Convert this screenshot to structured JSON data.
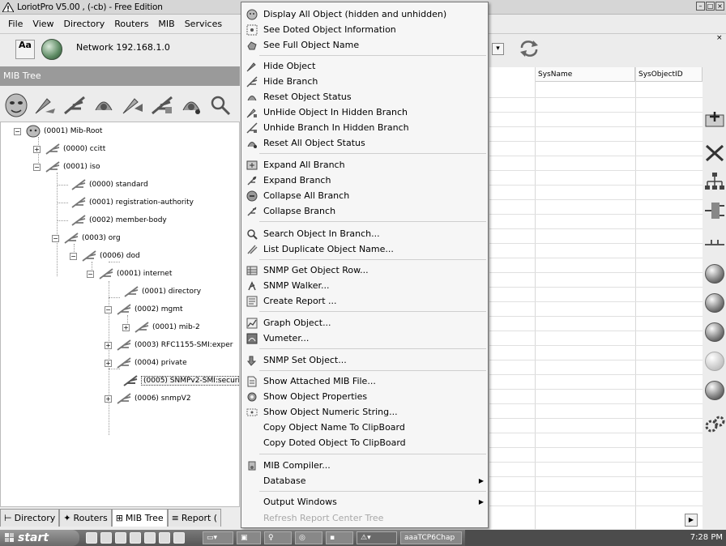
{
  "app": {
    "title": "LoriotPro V5.00 , (-cb) - Free Edition",
    "menus": [
      "File",
      "View",
      "Directory",
      "Routers",
      "MIB",
      "Services"
    ]
  },
  "toolbar": {
    "aa_label": "Aa",
    "network_label": "Network 192.168.1.0"
  },
  "mib_panel": {
    "header": "MIB Tree"
  },
  "tree": {
    "nodes": [
      {
        "label": "(0001) Mib-Root",
        "expander": "⊟"
      },
      {
        "label": "(0000) ccitt",
        "expander": "⊞"
      },
      {
        "label": "(0001) iso",
        "expander": "⊟"
      },
      {
        "label": "(0000) standard",
        "expander": ""
      },
      {
        "label": "(0001) registration-authority",
        "expander": ""
      },
      {
        "label": "(0002) member-body",
        "expander": ""
      },
      {
        "label": "(0003) org",
        "expander": "⊟"
      },
      {
        "label": "(0006) dod",
        "expander": "⊟"
      },
      {
        "label": "(0001) internet",
        "expander": "⊟"
      },
      {
        "label": "(0001) directory",
        "expander": ""
      },
      {
        "label": "(0002) mgmt",
        "expander": "⊟"
      },
      {
        "label": "(0001) mib-2",
        "expander": "⊞"
      },
      {
        "label": "(0003) RFC1155-SMI:exper",
        "expander": "⊞"
      },
      {
        "label": "(0004) private",
        "expander": "⊞"
      },
      {
        "label": "(0005) SNMPv2-SMI:securit",
        "expander": ""
      },
      {
        "label": "(0006) snmpV2",
        "expander": "⊞"
      }
    ]
  },
  "tabs": [
    "Directory",
    "Routers",
    "MIB Tree",
    "Report ("
  ],
  "table": {
    "columns": [
      "SysName",
      "SysObjectID"
    ]
  },
  "context_menu": {
    "items": [
      {
        "label": "Display All Object  (hidden and unhidden)"
      },
      {
        "label": "See Doted Object  Information"
      },
      {
        "label": "See Full Object Name"
      },
      {
        "label": "Hide Object"
      },
      {
        "label": "Hide Branch"
      },
      {
        "label": "Reset Object Status"
      },
      {
        "label": "UnHide Object In Hidden Branch"
      },
      {
        "label": "Unhide Branch In Hidden Branch"
      },
      {
        "label": "Reset All Object Status"
      },
      {
        "label": "Expand All Branch"
      },
      {
        "label": "Expand Branch"
      },
      {
        "label": "Collapse All Branch"
      },
      {
        "label": "Collapse Branch"
      },
      {
        "label": "Search Object In Branch..."
      },
      {
        "label": "List Duplicate Object Name..."
      },
      {
        "label": "SNMP Get Object Row..."
      },
      {
        "label": "SNMP Walker..."
      },
      {
        "label": "Create Report ..."
      },
      {
        "label": "Graph Object..."
      },
      {
        "label": "Vumeter..."
      },
      {
        "label": "SNMP Set Object..."
      },
      {
        "label": "Show Attached MIB File..."
      },
      {
        "label": "Show Object Properties"
      },
      {
        "label": "Show Object Numeric String..."
      },
      {
        "label": "Copy Object Name To ClipBoard"
      },
      {
        "label": "Copy Doted Object To ClipBoard"
      },
      {
        "label": "MIB Compiler..."
      },
      {
        "label": "Database",
        "submenu": "▶"
      },
      {
        "label": "Output Windows",
        "submenu": "▶"
      },
      {
        "label": "Refresh Report Center Tree",
        "disabled": true
      }
    ]
  },
  "taskbar": {
    "start_label": "start",
    "task1_label": "aaaTCP6Chap",
    "clock": "7:28 PM"
  },
  "colors": {
    "mib_header_bg": "#9a9a9a",
    "menu_bg": "#f6f6f6",
    "taskbar_bg": "#666666"
  }
}
